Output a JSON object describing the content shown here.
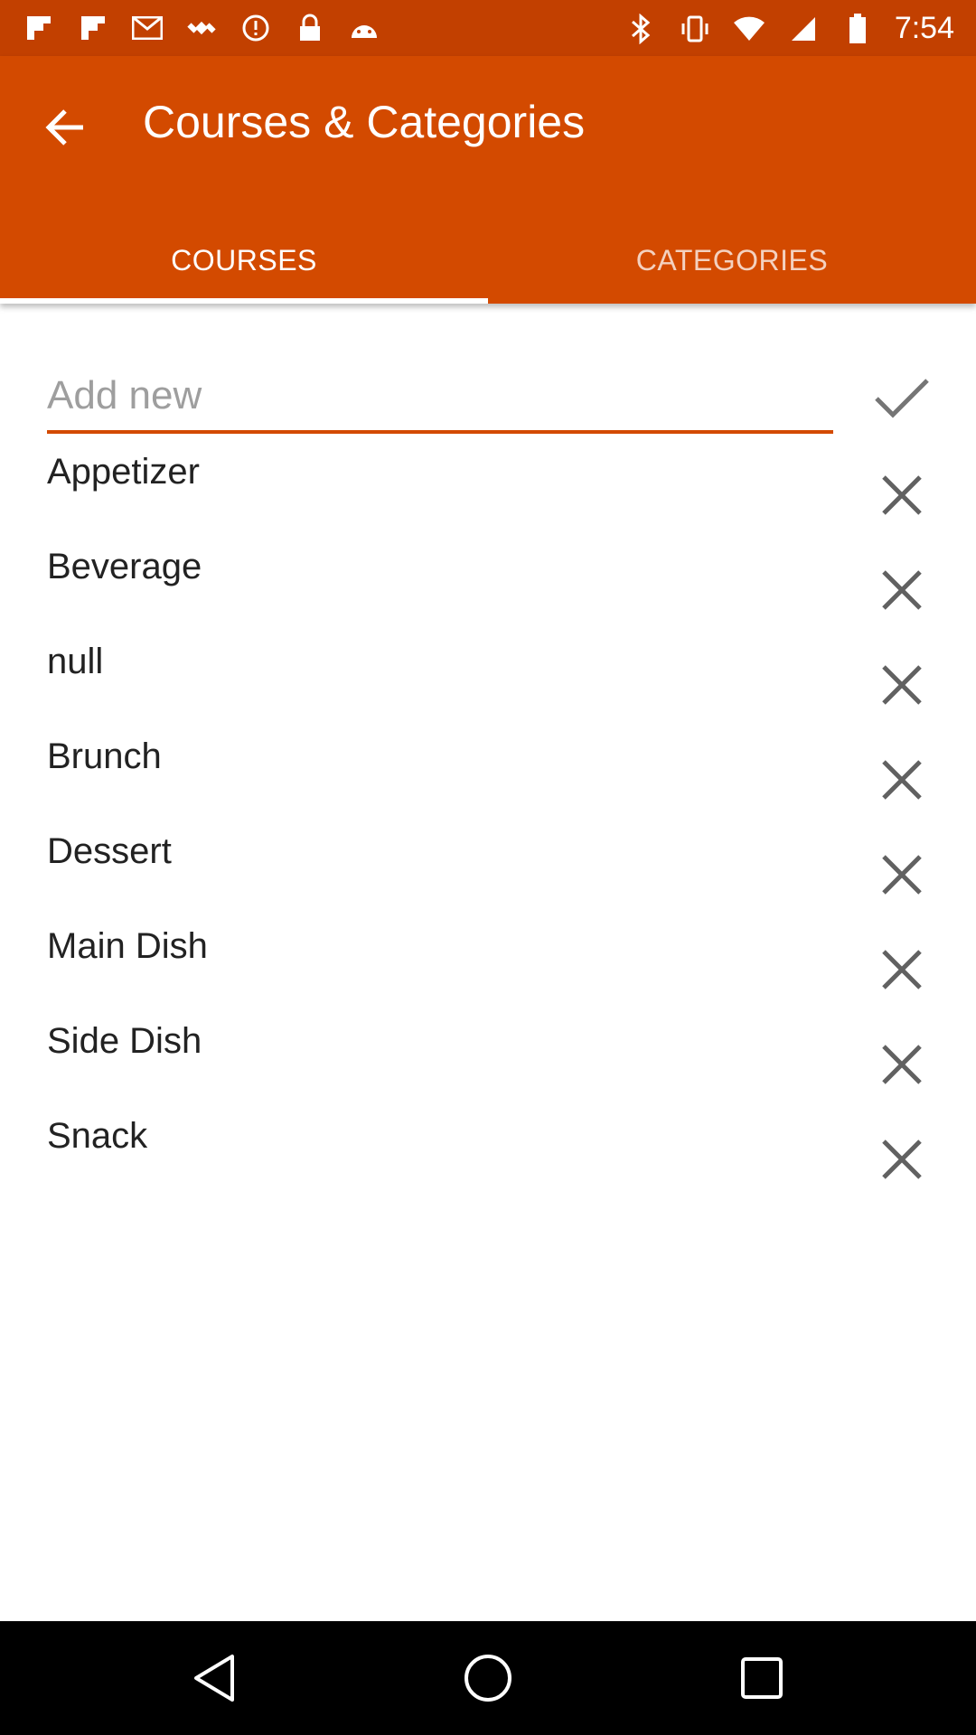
{
  "status_bar": {
    "time": "7:54",
    "left_icons": [
      "flipboard-icon",
      "flipboard-icon",
      "mail-icon",
      "fake-gps-icon",
      "info-icon",
      "lock-icon",
      "android-icon"
    ],
    "right_icons": [
      "bluetooth-icon",
      "vibrate-icon",
      "wifi-icon",
      "signal-icon",
      "battery-icon"
    ]
  },
  "app_bar": {
    "title": "Courses & Categories",
    "tabs": [
      {
        "label": "COURSES",
        "active": true
      },
      {
        "label": "CATEGORIES",
        "active": false
      }
    ]
  },
  "add": {
    "placeholder": "Add new",
    "value": ""
  },
  "items": [
    {
      "label": "Appetizer"
    },
    {
      "label": "Beverage"
    },
    {
      "label": "null"
    },
    {
      "label": "Brunch"
    },
    {
      "label": "Dessert"
    },
    {
      "label": "Main Dish"
    },
    {
      "label": "Side Dish"
    },
    {
      "label": "Snack"
    }
  ],
  "colors": {
    "status_bar": "#c24000",
    "app_bar": "#d34a00",
    "accent": "#d34a00"
  }
}
